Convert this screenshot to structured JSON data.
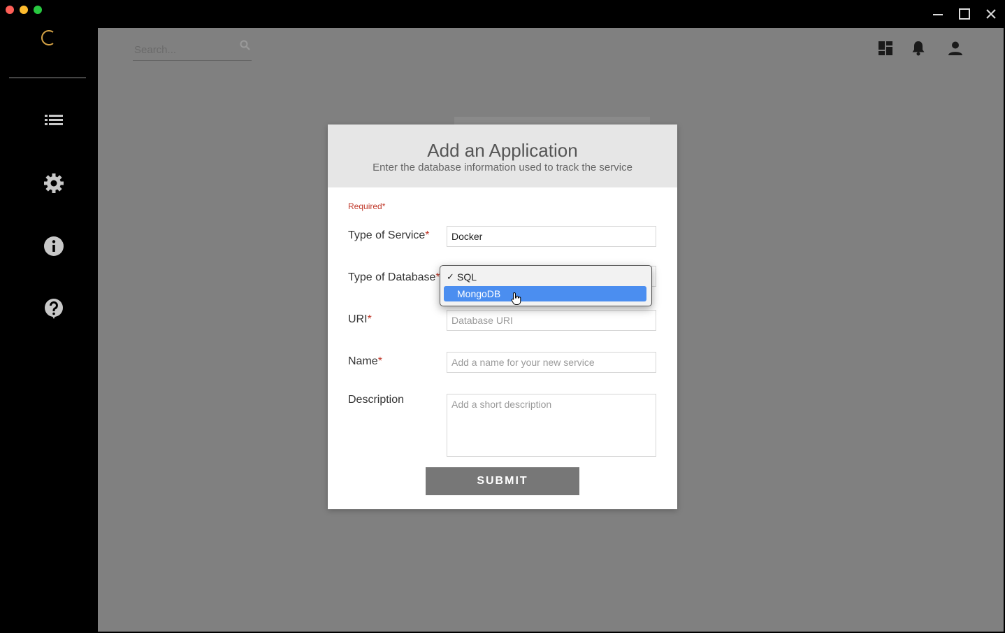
{
  "colors": {
    "accent_blue": "#4b8ef0",
    "required_red": "#c0392b",
    "logo_orange": "#d4a245",
    "traffic_red": "#fe5f57",
    "traffic_yellow": "#febc2e",
    "traffic_green": "#28c840"
  },
  "window": {
    "controls": [
      "minimize-icon",
      "maximize-icon",
      "close-icon"
    ]
  },
  "sidebar": {
    "items": [
      {
        "icon": "list-icon"
      },
      {
        "icon": "gear-icon"
      },
      {
        "icon": "info-icon"
      },
      {
        "icon": "help-icon"
      }
    ]
  },
  "topbar": {
    "search_placeholder": "Search...",
    "icons": [
      "dashboard-icon",
      "bell-icon",
      "user-icon"
    ]
  },
  "modal": {
    "title": "Add an Application",
    "subtitle": "Enter the database information used to track the service",
    "required_note": "Required*",
    "fields": {
      "service_type": {
        "label": "Type of Service",
        "value": "Docker"
      },
      "database_type": {
        "label": "Type of Database",
        "options": [
          "SQL",
          "MongoDB"
        ],
        "checked": "SQL",
        "highlighted": "MongoDB"
      },
      "uri": {
        "label": "URI",
        "placeholder": "Database URI"
      },
      "name": {
        "label": "Name",
        "placeholder": "Add a name for your new service"
      },
      "description": {
        "label": "Description",
        "placeholder": "Add a short description"
      }
    },
    "submit_label": "SUBMIT"
  }
}
